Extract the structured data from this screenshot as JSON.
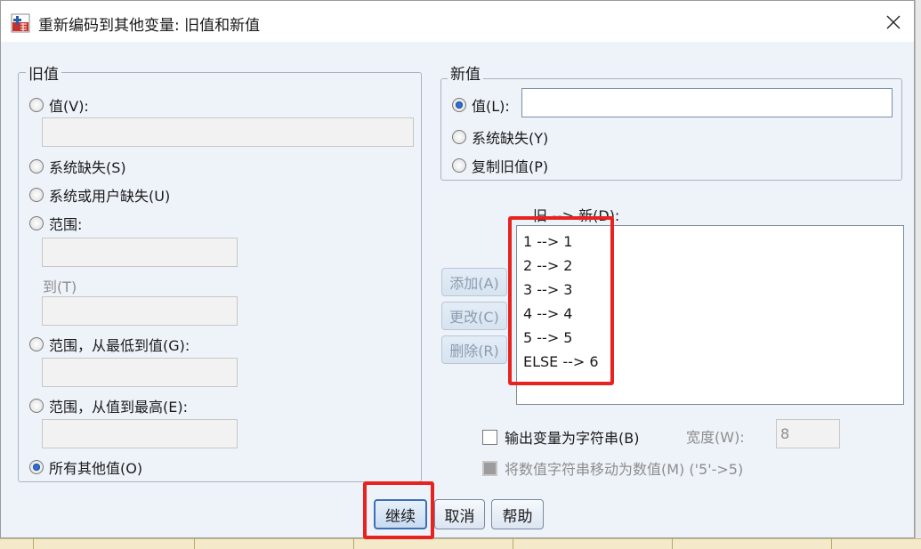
{
  "window": {
    "title": "重新编码到其他变量: 旧值和新值"
  },
  "old_value": {
    "legend": "旧值",
    "value_radio": "值(V):",
    "system_missing": "系统缺失(S)",
    "system_or_user_missing": "系统或用户缺失(U)",
    "range": "范围:",
    "through": "到(T)",
    "range_lowest": "范围，从最低到值(G):",
    "range_highest": "范围，从值到最高(E):",
    "all_other": "所有其他值(O)"
  },
  "new_value": {
    "legend": "新值",
    "value_radio": "值(L):",
    "value_input": "",
    "system_missing": "系统缺失(Y)",
    "copy_old": "复制旧值(P)"
  },
  "mapping": {
    "label": "旧 --> 新(D):",
    "items": [
      "1 --> 1",
      "2 --> 2",
      "3 --> 3",
      "4 --> 4",
      "5 --> 5",
      "ELSE --> 6"
    ]
  },
  "side_buttons": {
    "add": "添加(A)",
    "change": "更改(C)",
    "remove": "删除(R)"
  },
  "options": {
    "output_string": "输出变量为字符串(B)",
    "width_label": "宽度(W):",
    "width_value": "8",
    "convert_numeric": "将数值字符串移动为数值(M) ('5'->5)"
  },
  "footer": {
    "continue": "继续",
    "cancel": "取消",
    "help": "帮助"
  },
  "colors": {
    "highlight": "#e8231f",
    "radio_selected": "#2f6fd3"
  }
}
